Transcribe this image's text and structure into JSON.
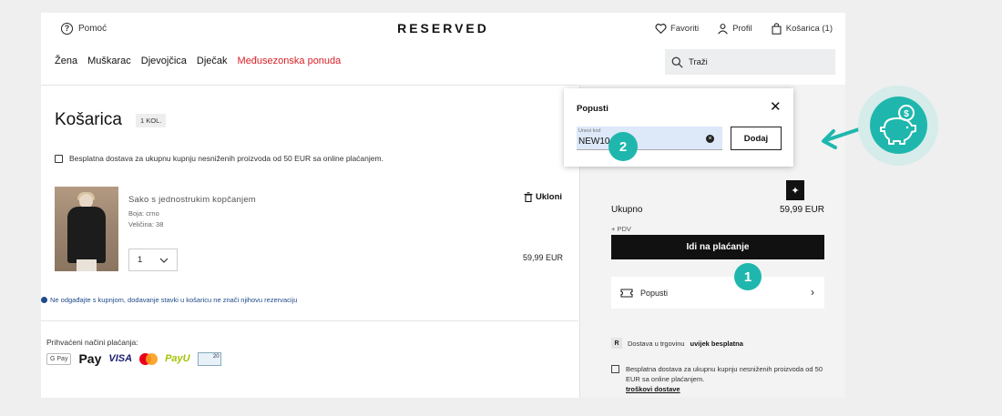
{
  "header": {
    "help": "Pomoć",
    "logo": "RESERVED",
    "favorites": "Favoriti",
    "profile": "Profil",
    "cart": "Košarica (1)"
  },
  "nav": [
    "Žena",
    "Muškarac",
    "Djevojčica",
    "Dječak",
    "Međusezonska ponuda"
  ],
  "search": {
    "placeholder": "Traži"
  },
  "cart": {
    "title": "Košarica",
    "count": "1 KOL.",
    "free_shipping": "Besplatna dostava za ukupnu kupnju nesniženih proizvoda od 50 EUR sa online plaćanjem.",
    "item": {
      "name": "Sako s jednostrukim kopčanjem",
      "color": "Boja: crno",
      "size": "Veličina: 38",
      "qty": "1",
      "remove": "Ukloni",
      "price": "59,99 EUR"
    },
    "reserve_note": "Ne odgađajte s kupnjom, dodavanje stavki u košaricu ne znači njihovu rezervaciju",
    "payment_label": "Prihvaćeni načini plaćanja:",
    "payment_logos": {
      "gpay": "G Pay",
      "apple": " Pay",
      "visa": "VISA",
      "payu": "PayU",
      "card": "20"
    }
  },
  "popup": {
    "title": "Popusti",
    "input_label": "Unesi kod",
    "input_value": "NEW10",
    "add_button": "Dodaj"
  },
  "summary": {
    "subtotal_label": "Ukupno",
    "subtotal_value": "59,99 EUR",
    "vat": "+ PDV",
    "checkout": "Idi na plaćanje",
    "discounts": "Popusti",
    "store_delivery_prefix": "Dostava u trgovinu",
    "store_delivery_bold": "uvijek besplatna",
    "store_badge": "R",
    "free_shipping": "Besplatna dostava za ukupnu kupnju nesniženih proizvoda od 50 EUR sa online plaćanjem.",
    "shipping_costs_link": "troškovi dostave"
  },
  "steps": {
    "one": "1",
    "two": "2"
  },
  "colors": {
    "accent": "#1fb7ad",
    "promo": "#d92026",
    "dark": "#111111",
    "note": "#1f4a8a"
  }
}
